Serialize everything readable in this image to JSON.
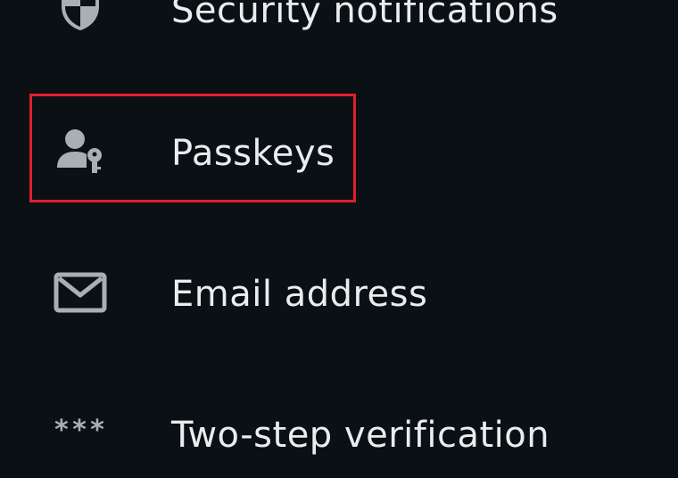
{
  "security_menu": {
    "items": [
      {
        "id": "security",
        "label": "Security notifications",
        "icon": "shield-icon"
      },
      {
        "id": "passkeys",
        "label": "Passkeys",
        "icon": "person-key-icon"
      },
      {
        "id": "email",
        "label": "Email address",
        "icon": "envelope-icon"
      },
      {
        "id": "twostep",
        "label": "Two-step verification",
        "icon": "asterisks-icon",
        "icon_text": "***"
      }
    ]
  },
  "highlight": {
    "target": "Passkeys",
    "color": "#e0202c"
  },
  "colors": {
    "background": "#0b1014",
    "text": "#e9edf0",
    "icon": "#a9b0b5",
    "highlight": "#e0202c"
  }
}
